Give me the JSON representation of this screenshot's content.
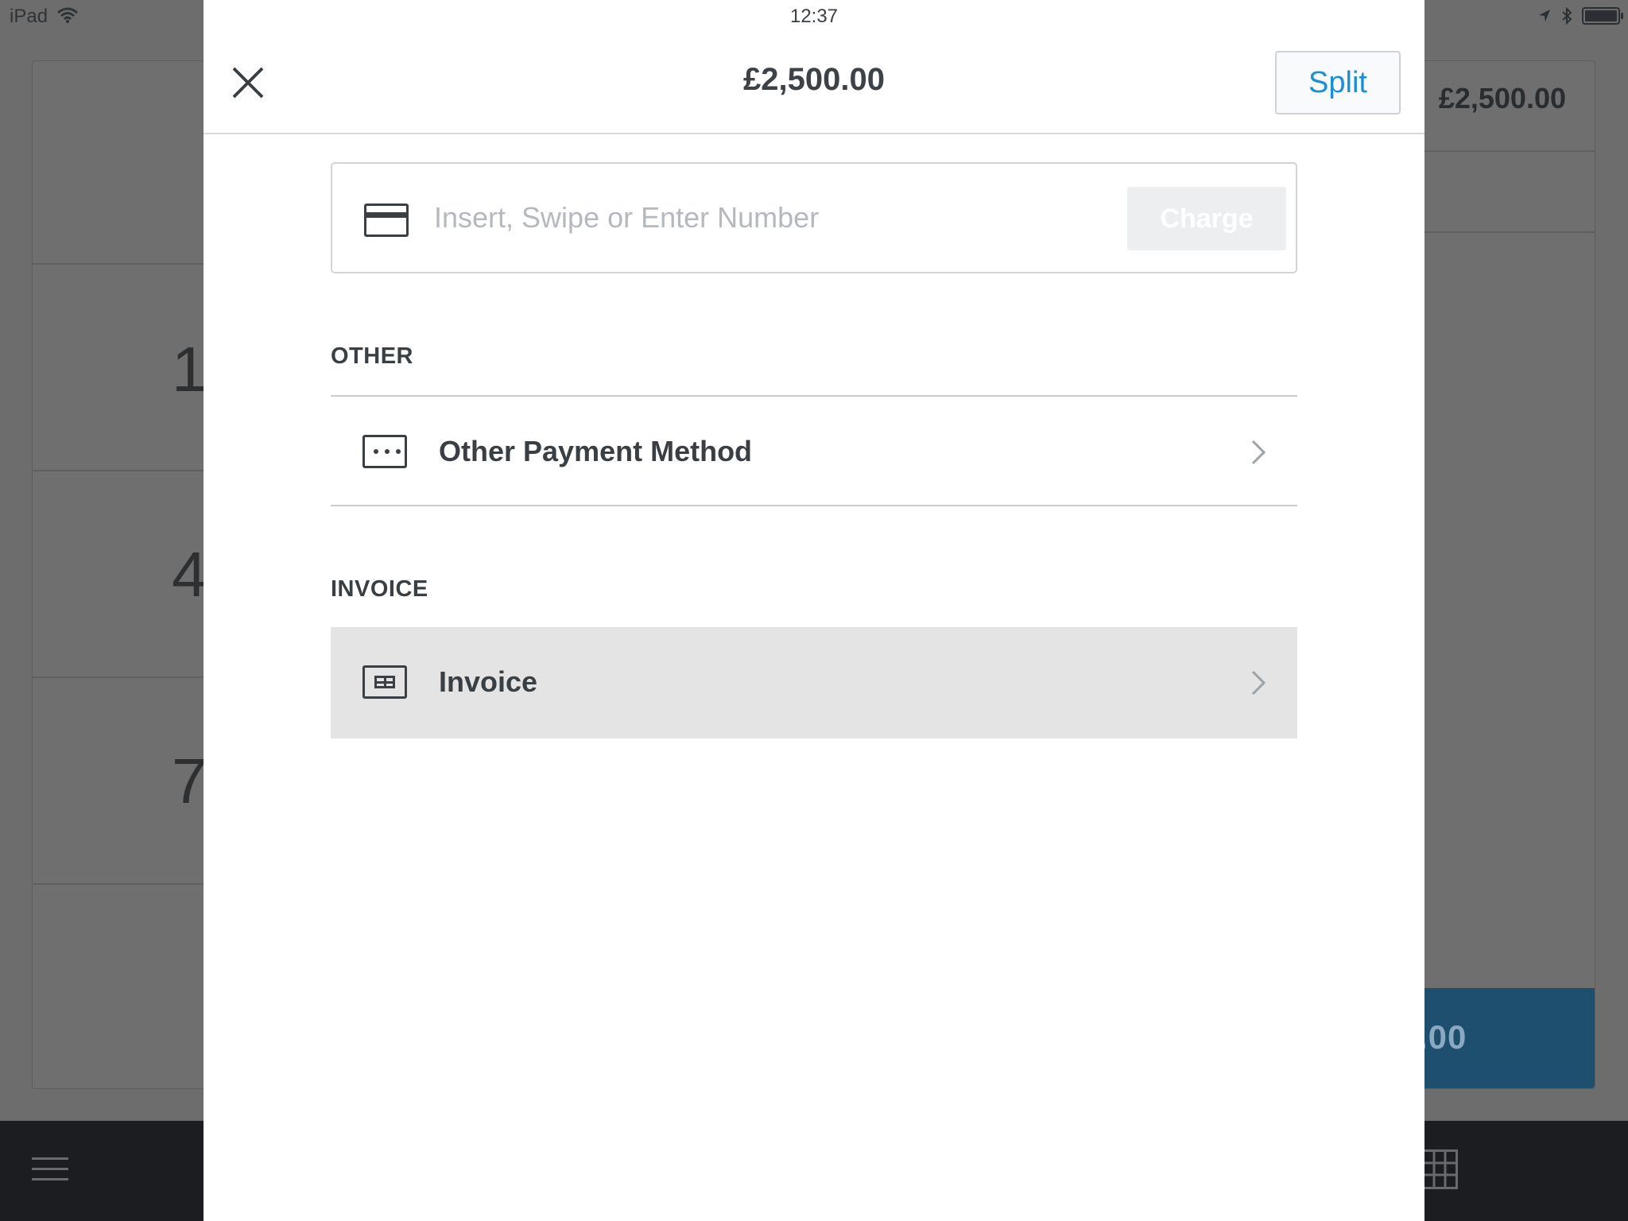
{
  "status_bar": {
    "device": "iPad",
    "time": "12:37"
  },
  "background": {
    "keypad_digits": [
      "1",
      "4",
      "7"
    ],
    "cart_total": "£2,500.00",
    "charge_amount_partial": ".00"
  },
  "modal": {
    "title": "£2,500.00",
    "split_label": "Split",
    "card_entry": {
      "placeholder": "Insert, Swipe or Enter Number",
      "charge_label": "Charge"
    },
    "sections": {
      "other": {
        "header": "OTHER",
        "item_label": "Other Payment Method"
      },
      "invoice": {
        "header": "INVOICE",
        "item_label": "Invoice"
      }
    }
  },
  "colors": {
    "accent": "#1b8fd6",
    "text": "#3a3f44",
    "overlay": "#6d6d6d",
    "highlight_row": "#e4e4e4"
  }
}
